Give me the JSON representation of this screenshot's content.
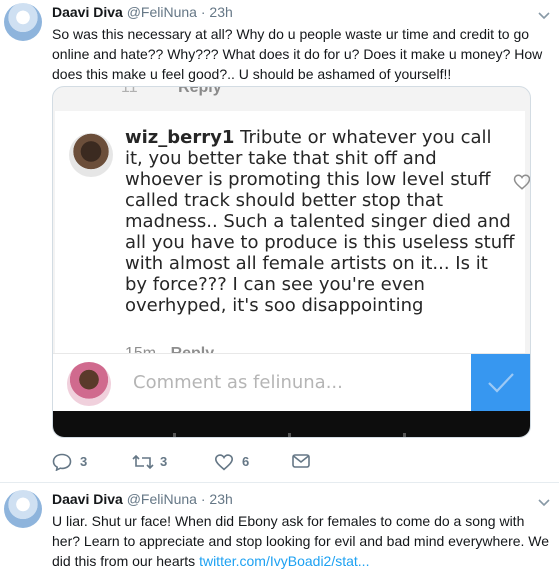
{
  "tweets": [
    {
      "name": "Daavi Diva",
      "handle": "@FeliNuna",
      "time": "23h",
      "text": "So was this necessary at all? Why do  u people waste ur time and credit to go online and hate?? Why??? What does it do for u? Does it make u money? How does this make u feel good?.. U should be ashamed of yourself!!",
      "embed": {
        "cut_reply": {
          "ghost": "11",
          "label": "Reply"
        },
        "comment": {
          "username": "wiz_berry1",
          "text": "Tribute or whatever you call it, you better take that shit off and whoever is promoting this low level stuff called track should better stop that madness.. Such a talented singer died and all you have to produce is this useless stuff with almost all female artists on it... Is it by force??? I can see you're even overhyped, it's soo disappointing",
          "time": "15m",
          "reply_label": "Reply"
        },
        "composer_placeholder": "Comment as felinuna..."
      },
      "actions": {
        "replies": "3",
        "retweets": "3",
        "likes": "6"
      }
    },
    {
      "name": "Daavi Diva",
      "handle": "@FeliNuna",
      "time": "23h",
      "text": "U liar. Shut ur face! When did Ebony ask for females to come do a song with her? Learn to appreciate and stop looking for evil and bad mind everywhere. We did this from our hearts ",
      "link": "twitter.com/IvyBoadi2/stat..."
    }
  ],
  "colors": {
    "link": "#1da1f2",
    "meta": "#657786",
    "send_button": "#3797f0"
  },
  "icons": [
    "caret-down-icon",
    "heart-outline-icon",
    "checkmark-icon",
    "reply-icon",
    "retweet-icon",
    "like-icon",
    "direct-message-icon"
  ]
}
